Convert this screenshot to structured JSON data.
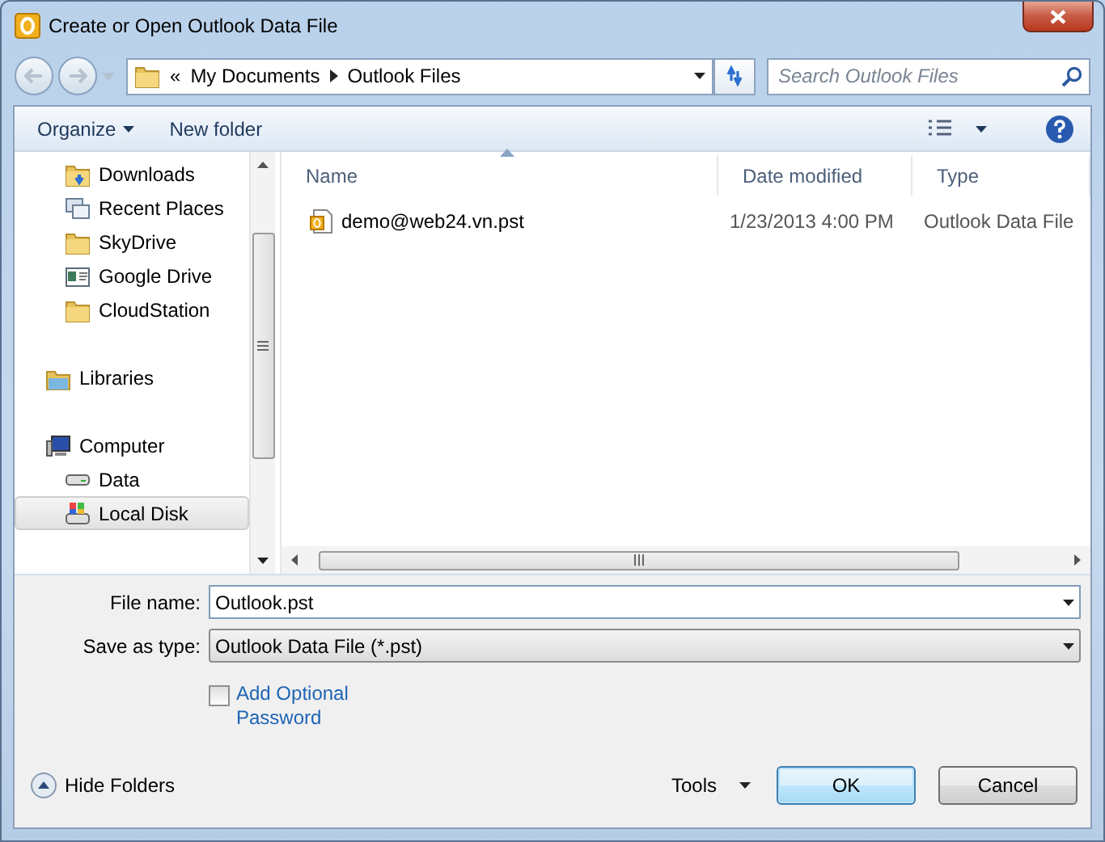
{
  "window": {
    "title": "Create or Open Outlook Data File"
  },
  "address_bar": {
    "overflow_mark": "«",
    "path": [
      {
        "label": "My Documents"
      },
      {
        "label": "Outlook Files"
      }
    ]
  },
  "search": {
    "placeholder": "Search Outlook Files"
  },
  "toolbar": {
    "organize": "Organize",
    "new_folder": "New folder"
  },
  "sidebar": {
    "favorites": [
      {
        "label": "Downloads",
        "kind": "downloads",
        "selected": false
      },
      {
        "label": "Recent Places",
        "kind": "recent",
        "selected": false
      },
      {
        "label": "SkyDrive",
        "kind": "folder",
        "selected": false
      },
      {
        "label": "Google Drive",
        "kind": "drive",
        "selected": false
      },
      {
        "label": "CloudStation",
        "kind": "folder",
        "selected": false
      }
    ],
    "nodes": [
      {
        "label": "Libraries",
        "kind": "library",
        "selected": false
      },
      {
        "label": "Computer",
        "kind": "computer",
        "selected": false,
        "children": [
          {
            "label": "Data",
            "kind": "disk",
            "selected": false
          },
          {
            "label": "Local Disk",
            "kind": "system-disk",
            "selected": true
          }
        ]
      }
    ]
  },
  "file_list": {
    "columns": [
      {
        "label": "Name",
        "sorted": true
      },
      {
        "label": "Date modified",
        "sorted": false
      },
      {
        "label": "Type",
        "sorted": false
      }
    ],
    "rows": [
      {
        "name": "demo@web24.vn.pst",
        "date_modified": "1/23/2013 4:00 PM",
        "type": "Outlook Data File"
      }
    ]
  },
  "form": {
    "file_name": {
      "label": "File name:",
      "value": "Outlook.pst"
    },
    "save_as_type": {
      "label": "Save as type:",
      "value": "Outlook Data File (*.pst)"
    },
    "password_option": {
      "label": "Add Optional Password",
      "checked": false
    }
  },
  "footer": {
    "hide_folders": "Hide Folders",
    "tools": "Tools",
    "buttons": [
      {
        "label": "OK",
        "default": true
      },
      {
        "label": "Cancel",
        "default": false
      }
    ]
  }
}
